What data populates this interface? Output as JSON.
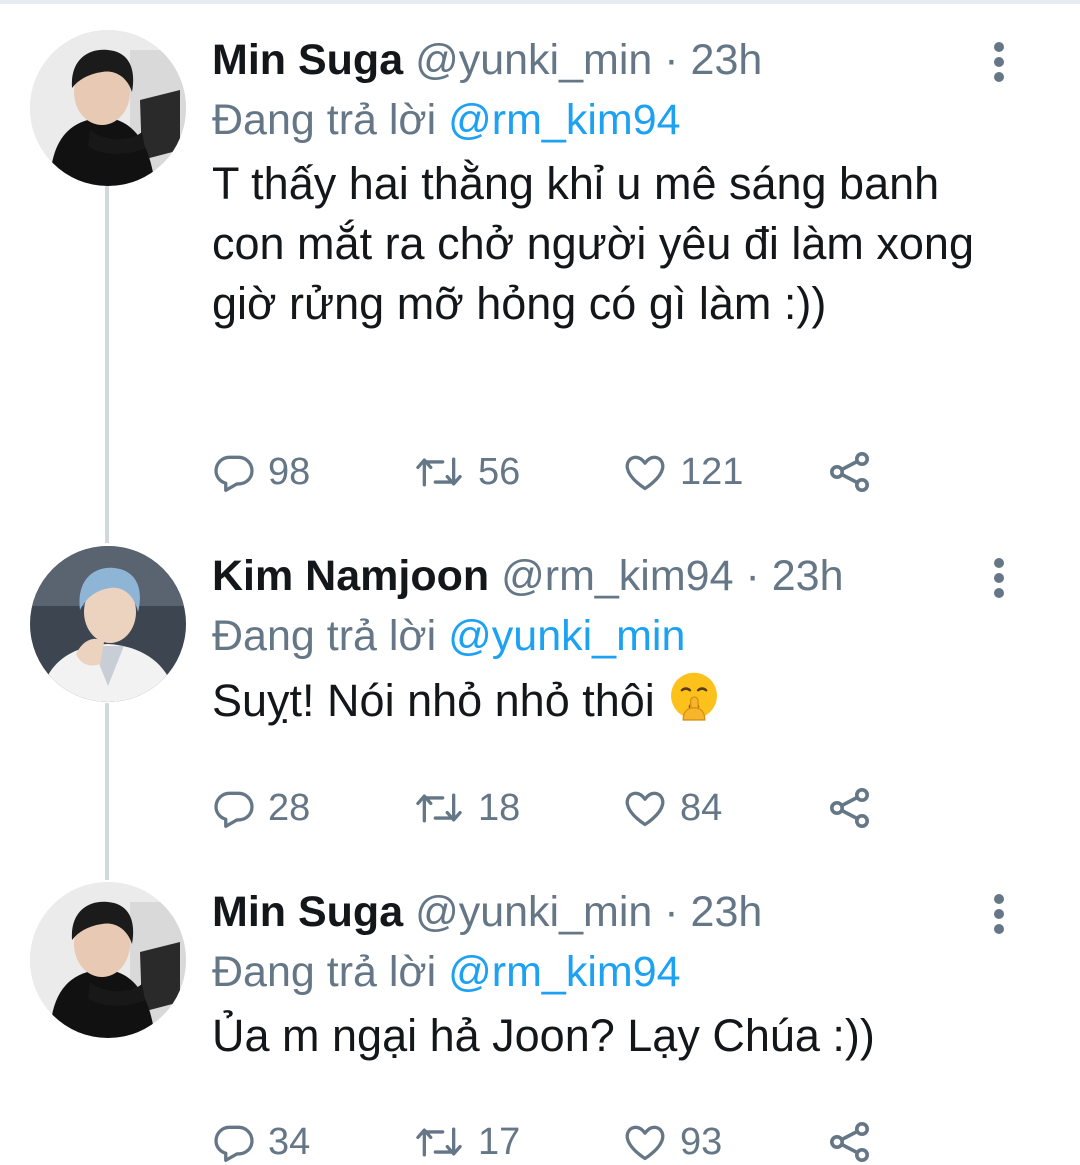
{
  "tweets": [
    {
      "name": "Min Suga",
      "handle": "@yunki_min",
      "separator": "·",
      "time": "23h",
      "reply_prefix": "Đang trả lời",
      "reply_to": "@rm_kim94",
      "text": "T thấy hai thằng khỉ u mê sáng banh con mắt ra chở người yêu đi làm xong giờ rửng mỡ hỏng có gì làm :))",
      "replies": "98",
      "retweets": "56",
      "likes": "121"
    },
    {
      "name": "Kim Namjoon",
      "handle": "@rm_kim94",
      "separator": "·",
      "time": "23h",
      "reply_prefix": "Đang trả lời",
      "reply_to": "@yunki_min",
      "text": "Suỵt! Nói nhỏ nhỏ thôi",
      "emoji": "shushing-face-emoji",
      "replies": "28",
      "retweets": "18",
      "likes": "84"
    },
    {
      "name": "Min Suga",
      "handle": "@yunki_min",
      "separator": "·",
      "time": "23h",
      "reply_prefix": "Đang trả lời",
      "reply_to": "@rm_kim94",
      "text": "Ủa m ngại hả Joon? Lạy Chúa :))",
      "replies": "34",
      "retweets": "17",
      "likes": "93"
    }
  ],
  "colors": {
    "name": "#14171a",
    "secondary": "#657786",
    "mention": "#1da1f2",
    "thread_line": "#cfd9de"
  },
  "icons": [
    "reply-icon",
    "retweet-icon",
    "like-icon",
    "share-icon",
    "more-options-icon"
  ]
}
